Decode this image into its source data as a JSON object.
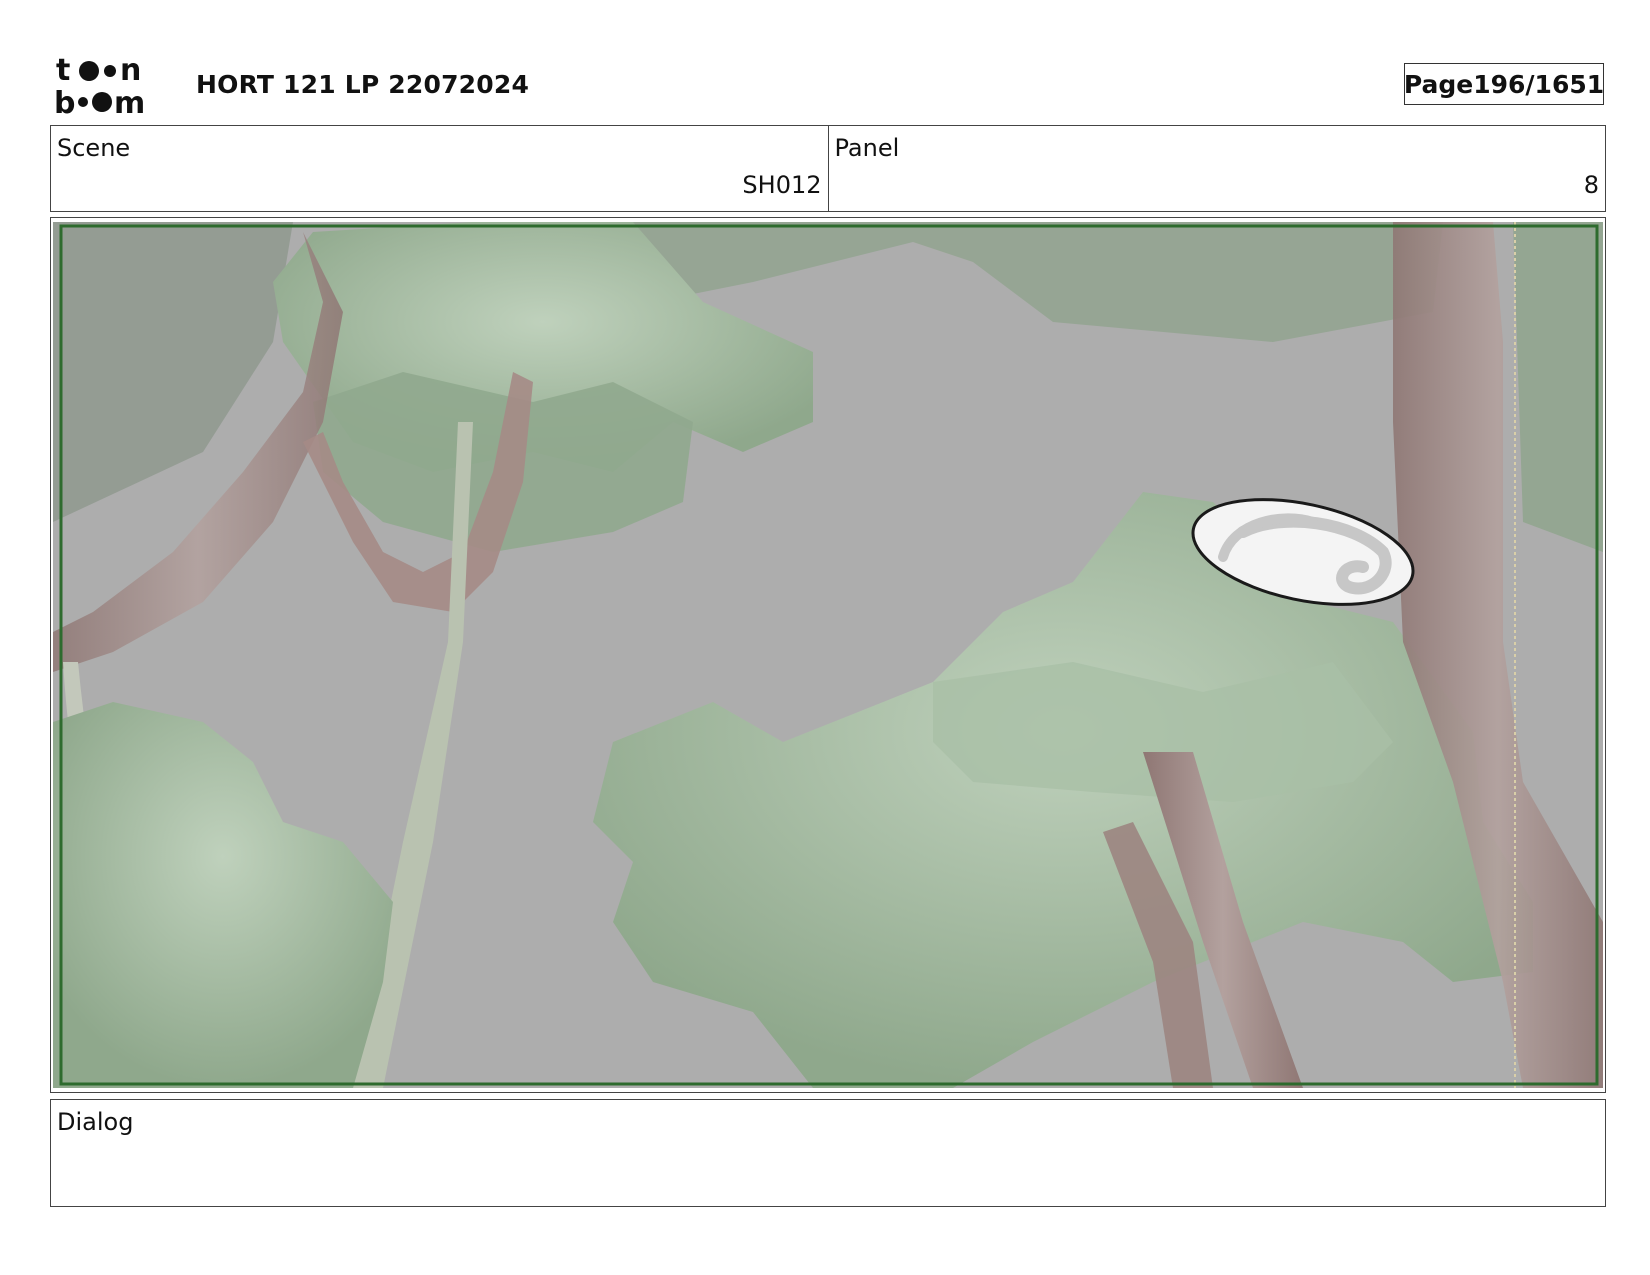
{
  "header": {
    "logo_text": "toon boom",
    "title": "HORT 121 LP 22072024",
    "page_label": "Page",
    "page_number": "196/1651"
  },
  "scene": {
    "label": "Scene",
    "value": "SH012"
  },
  "panel": {
    "label": "Panel",
    "value": "8"
  },
  "dialog": {
    "label": "Dialog",
    "text": ""
  },
  "colors": {
    "background": "#ffffff",
    "border": "#444444",
    "safe_frame": "#2e6b2e",
    "scene_bg": "#adadad",
    "foliage": "#9fb59c",
    "branch": "#a08a86"
  }
}
